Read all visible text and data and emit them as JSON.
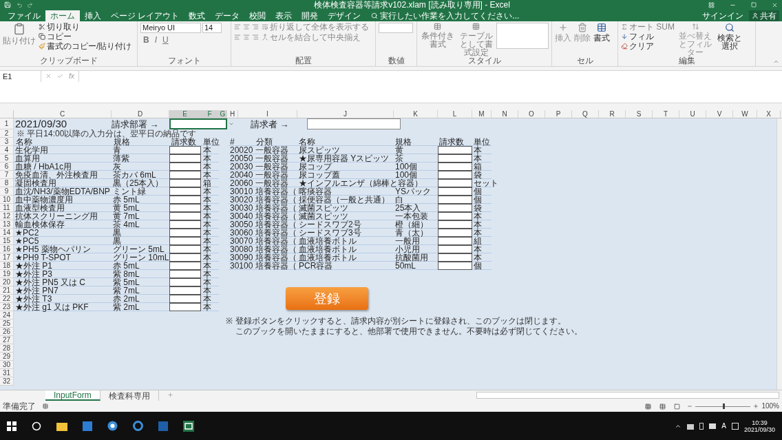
{
  "window": {
    "title": "検体検査容器等請求v102.xlam [読み取り専用] - Excel"
  },
  "ribbon_tabs": [
    {
      "label": "ファイル",
      "selected": false
    },
    {
      "label": "ホーム",
      "selected": true
    },
    {
      "label": "挿入",
      "selected": false
    },
    {
      "label": "ページ レイアウト",
      "selected": false
    },
    {
      "label": "数式",
      "selected": false
    },
    {
      "label": "データ",
      "selected": false
    },
    {
      "label": "校閲",
      "selected": false
    },
    {
      "label": "表示",
      "selected": false
    },
    {
      "label": "開発",
      "selected": false
    },
    {
      "label": "デザイン",
      "selected": false
    }
  ],
  "tell_me": {
    "placeholder": "実行したい作業を入力してください..."
  },
  "account": {
    "sign_in": "サインイン",
    "share": "共有"
  },
  "clipboard": {
    "paste": "貼り付け",
    "cut": "切り取り",
    "copy": "コピー",
    "format_painter": "書式のコピー/貼り付け",
    "label": "クリップボード"
  },
  "font": {
    "name": "Meiryo UI",
    "size": "14",
    "buttons": [
      "B",
      "I",
      "U"
    ],
    "label": "フォント"
  },
  "alignment": {
    "wrap": "折り返して全体を表示する",
    "merge": "セルを結合して中央揃え",
    "label": "配置"
  },
  "number": {
    "label": "数値"
  },
  "styles": {
    "conditional": "条件付き書式",
    "table": "テーブルとして書式設定",
    "label": "スタイル"
  },
  "cells": {
    "insert": "挿入",
    "delete": "削除",
    "format": "書式",
    "label": "セル"
  },
  "editing": {
    "autosum": "オート SUM",
    "fill": "フィル",
    "clear": "クリア",
    "sort": "並べ替えとフィルター",
    "find": "検索と選択",
    "label": "編集"
  },
  "formula_bar": {
    "name_box": "E1",
    "fx": "fx"
  },
  "columns": [
    {
      "label": "C",
      "selected": false
    },
    {
      "label": "D",
      "selected": false
    },
    {
      "label": "E",
      "selected": true
    },
    {
      "label": "F",
      "selected": true
    },
    {
      "label": "G",
      "selected": true
    },
    {
      "label": "H",
      "selected": false
    },
    {
      "label": "I",
      "selected": false
    },
    {
      "label": "J",
      "selected": false
    },
    {
      "label": "K",
      "selected": false
    },
    {
      "label": "L",
      "selected": false
    },
    {
      "label": "M",
      "selected": false
    },
    {
      "label": "N",
      "selected": false
    },
    {
      "label": "O",
      "selected": false
    },
    {
      "label": "P",
      "selected": false
    },
    {
      "label": "Q",
      "selected": false
    },
    {
      "label": "R",
      "selected": false
    },
    {
      "label": "S",
      "selected": false
    },
    {
      "label": "T",
      "selected": false
    },
    {
      "label": "U",
      "selected": false
    },
    {
      "label": "V",
      "selected": false
    },
    {
      "label": "W",
      "selected": false
    },
    {
      "label": "X",
      "selected": false
    }
  ],
  "row_numbers": [
    "1",
    "2",
    "3",
    "4",
    "5",
    "6",
    "7",
    "8",
    "9",
    "10",
    "11",
    "12",
    "13",
    "14",
    "15",
    "16",
    "17",
    "18",
    "19",
    "20",
    "21",
    "22",
    "23",
    "24",
    "25",
    "26",
    "27",
    "28",
    "29",
    "30",
    "31",
    "32"
  ],
  "sheet": {
    "date": "2021/09/30",
    "dept_label": "請求部署 →",
    "requester_label": "請求者 →",
    "note": "※ 平日14:00以降の入力分は、翌平日の納品です",
    "left_headers": [
      "名称",
      "規格",
      "請求数",
      "単位"
    ],
    "left_rows": [
      {
        "name": "生化学用",
        "spec": "青",
        "unit": "本"
      },
      {
        "name": "血算用",
        "spec": "薄紫",
        "unit": "本"
      },
      {
        "name": "血糖 / HbA1c用",
        "spec": "灰",
        "unit": "本"
      },
      {
        "name": "免疫血清、外注検査用",
        "spec": "茶カバ 6mL",
        "unit": "本"
      },
      {
        "name": "凝固検査用",
        "spec": "黒（25本入）",
        "unit": "箱"
      },
      {
        "name": "血沈/NH3/薬物EDTA/BNP",
        "spec": "ミント緑",
        "unit": "本"
      },
      {
        "name": "血中薬物濃度用",
        "spec": "赤 5mL",
        "unit": "本"
      },
      {
        "name": "血液型検査用",
        "spec": "黄 5mL",
        "unit": "本"
      },
      {
        "name": "抗体スクリーニング用",
        "spec": "黄 7mL",
        "unit": "本"
      },
      {
        "name": "輸血検体保存",
        "spec": "茶 4mL",
        "unit": "本"
      },
      {
        "name": "★PC2",
        "spec": "黒",
        "unit": "本"
      },
      {
        "name": "★PC5",
        "spec": "黒",
        "unit": "本"
      },
      {
        "name": "★PH5 薬物ヘパリン",
        "spec": "グリーン 5mL",
        "unit": "本"
      },
      {
        "name": "★PH9 T-SPOT",
        "spec": "グリーン 10mL",
        "unit": "本"
      },
      {
        "name": "★外注 P1",
        "spec": "赤 5mL",
        "unit": "本"
      },
      {
        "name": "★外注 P3",
        "spec": "紫 8mL",
        "unit": "本"
      },
      {
        "name": "★外注 PN5 又は C",
        "spec": "紫 5mL",
        "unit": "本"
      },
      {
        "name": "★外注 PN7",
        "spec": "紫 7mL",
        "unit": "本"
      },
      {
        "name": "★外注 T3",
        "spec": "赤 2mL",
        "unit": "本"
      },
      {
        "name": "★外注 g1 又は PKF",
        "spec": "紫 2mL",
        "unit": "本"
      }
    ],
    "right_headers": [
      "#",
      "分類",
      "名称",
      "規格",
      "請求数",
      "単位"
    ],
    "right_rows": [
      {
        "code": "20020",
        "category": "一般容器",
        "name": "尿スピッツ",
        "spec": "黄",
        "unit": "本"
      },
      {
        "code": "20050",
        "category": "一般容器",
        "name": "★尿専用容器 Yスピッツ",
        "spec": "茶",
        "unit": "本"
      },
      {
        "code": "20030",
        "category": "一般容器",
        "name": "尿コップ",
        "spec": "100個",
        "unit": "箱"
      },
      {
        "code": "20040",
        "category": "一般容器",
        "name": "尿コップ蓋",
        "spec": "100個",
        "unit": "袋"
      },
      {
        "code": "20060",
        "category": "一般容器",
        "name": "★インフルエンザ（綿棒と容器）",
        "unit": "セット"
      },
      {
        "code": "30010",
        "category": "培養容器（",
        "name": "喀痰容器",
        "spec": "YSパック",
        "unit": "個"
      },
      {
        "code": "30020",
        "category": "培養容器（",
        "name": "採便容器（一般と共通）",
        "spec": "白",
        "unit": "個"
      },
      {
        "code": "30030",
        "category": "培養容器（",
        "name": "滅菌スピッツ",
        "spec": "25本入",
        "unit": "袋"
      },
      {
        "code": "30040",
        "category": "培養容器（",
        "name": "滅菌スピッツ",
        "spec": "一本包装",
        "unit": "本"
      },
      {
        "code": "30050",
        "category": "培養容器（",
        "name": "シードスワブ2号",
        "spec": "橙（細）",
        "unit": "本"
      },
      {
        "code": "30060",
        "category": "培養容器（",
        "name": "シードスワブ3号",
        "spec": "青（太）",
        "unit": "本"
      },
      {
        "code": "30070",
        "category": "培養容器（",
        "name": "血液培養ボトル",
        "spec": "一般用",
        "unit": "組"
      },
      {
        "code": "30080",
        "category": "培養容器（",
        "name": "血液培養ボトル",
        "spec": "小児用",
        "unit": "本"
      },
      {
        "code": "30090",
        "category": "培養容器（",
        "name": "血液培養ボトル",
        "spec": "抗酸菌用",
        "unit": "本"
      },
      {
        "code": "30100",
        "category": "培養容器（",
        "name": "PCR容器",
        "spec": "50mL",
        "unit": "個"
      }
    ],
    "register_button": "登録",
    "notice": [
      "※",
      "登録ボタンをクリックすると、請求内容が別シートに登録され、このブックは閉じます。",
      "このブックを開いたままにすると、他部署で使用できません。不要時は必ず閉じてください。"
    ]
  },
  "sheet_tabs": [
    {
      "label": "InputForm",
      "selected": true
    },
    {
      "label": "検査科専用",
      "selected": false
    }
  ],
  "status": {
    "text": "準備完了",
    "zoom": {
      "level": 0.5,
      "reading": "100%"
    }
  },
  "taskbar": {
    "ime": "A",
    "time": "10:39",
    "date": "2021/09/30"
  }
}
